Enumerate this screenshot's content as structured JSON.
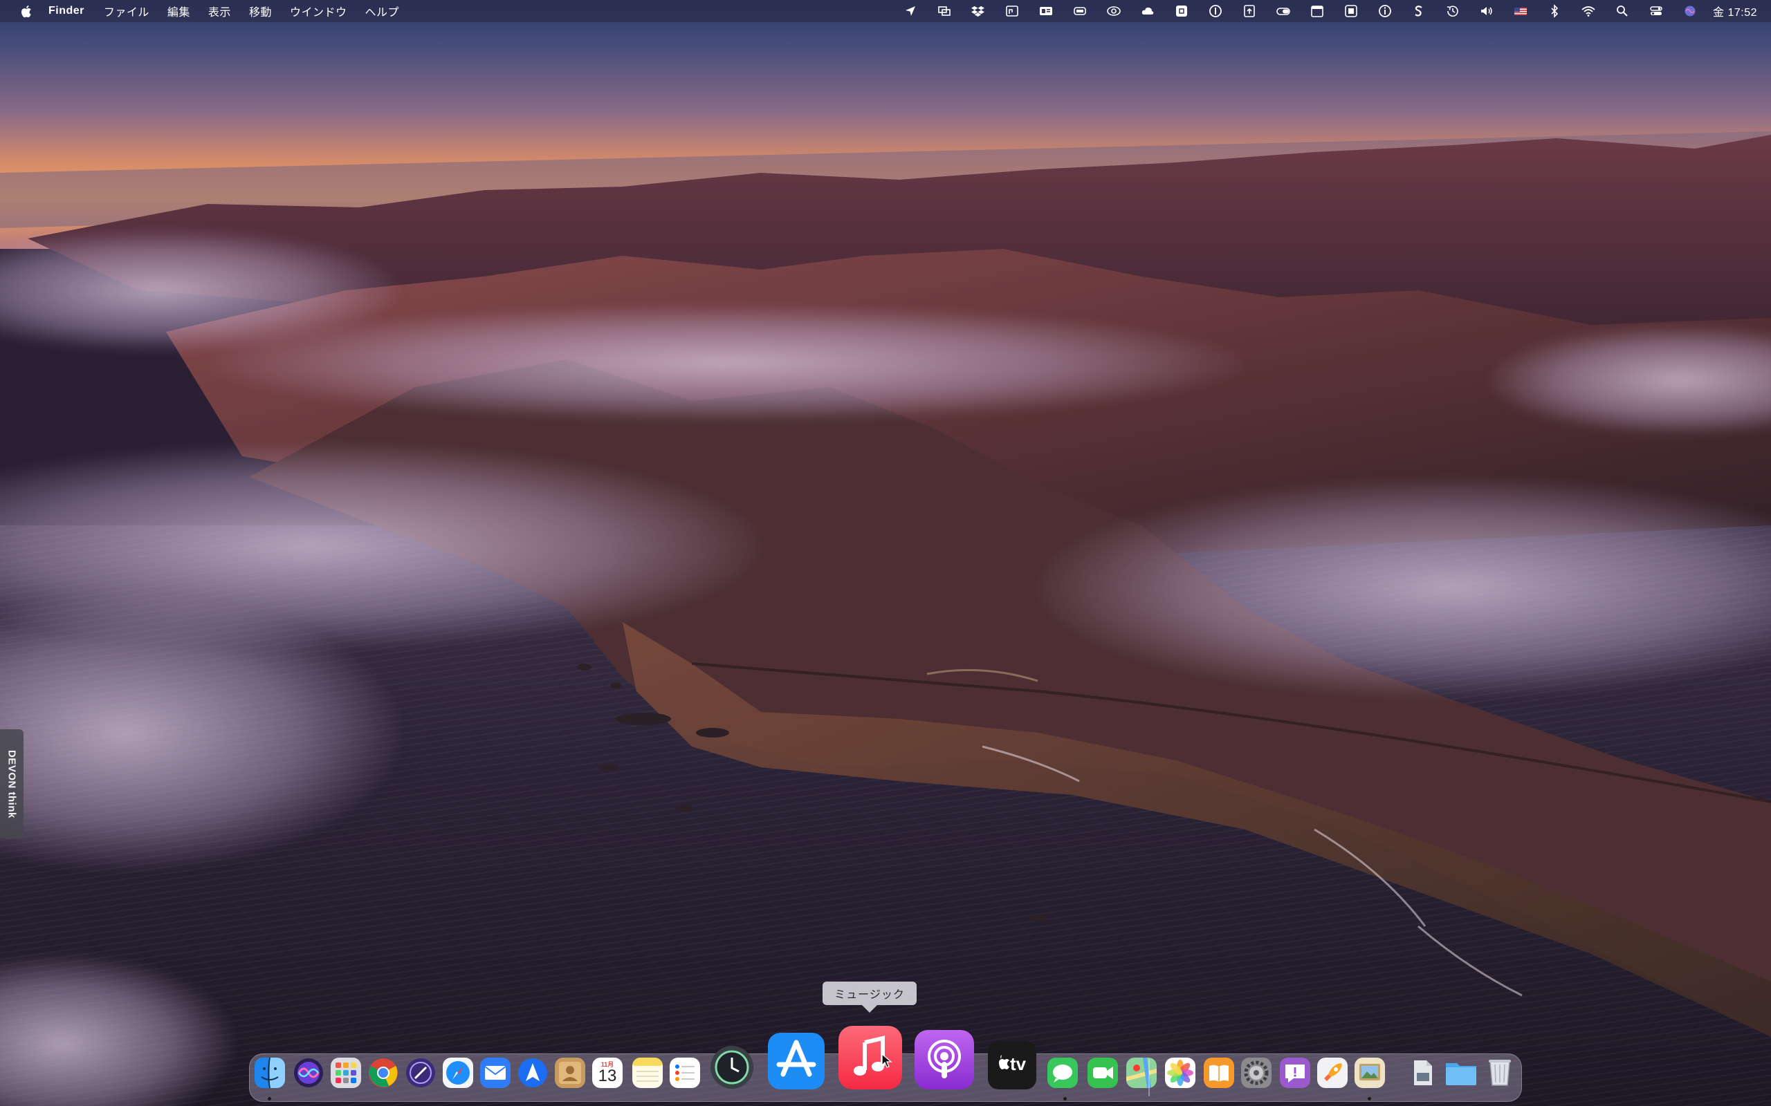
{
  "menubar": {
    "app_name": "Finder",
    "menus": [
      "ファイル",
      "編集",
      "表示",
      "移動",
      "ウインドウ",
      "ヘルプ"
    ],
    "clock": "金 17:52",
    "status_icons": [
      "location-arrow-icon",
      "screen-mirror-icon",
      "dropbox-icon",
      "display-icon",
      "card-icon",
      "battery-app-icon",
      "creative-cloud-icon",
      "cloud-icon",
      "command-icon",
      "one-password-icon",
      "upload-icon",
      "toggle-icon",
      "calendar-icon",
      "stack-icon",
      "info-icon",
      "scrivener-icon",
      "time-machine-icon",
      "volume-icon",
      "us-flag-icon",
      "bluetooth-icon",
      "wifi-icon",
      "spotlight-icon",
      "control-center-icon",
      "siri-icon"
    ]
  },
  "side_tab": {
    "label": "DEVON think"
  },
  "tooltip": {
    "label": "ミュージック"
  },
  "dock": {
    "apps": [
      {
        "name": "finder",
        "color": "#2d8cf0"
      },
      {
        "name": "siri",
        "color": "#6a3fd6"
      },
      {
        "name": "launchpad",
        "color": "#d9d9de"
      },
      {
        "name": "chrome",
        "color": "#ffffff"
      },
      {
        "name": "vpn",
        "color": "#3b2a7a"
      },
      {
        "name": "safari",
        "color": "#1f8fff"
      },
      {
        "name": "mail",
        "color": "#2f7df6"
      },
      {
        "name": "testflight",
        "color": "#1b6ef3"
      },
      {
        "name": "contacts",
        "color": "#c89a5e"
      },
      {
        "name": "calendar",
        "color": "#ffffff"
      },
      {
        "name": "notes",
        "color": "#f7d95c"
      },
      {
        "name": "reminders",
        "color": "#ffffff"
      },
      {
        "name": "time-machine",
        "color": "#3a3e45"
      },
      {
        "name": "app-store",
        "color": "#1d8cf5"
      },
      {
        "name": "music",
        "color": "#f7455b"
      },
      {
        "name": "podcasts",
        "color": "#9b45d6"
      },
      {
        "name": "apple-tv",
        "color": "#1a1a1a"
      },
      {
        "name": "messages",
        "color": "#37c75a"
      },
      {
        "name": "facetime",
        "color": "#35c24f"
      },
      {
        "name": "maps",
        "color": "#6cc07a"
      },
      {
        "name": "photos",
        "color": "#ffffff"
      },
      {
        "name": "books",
        "color": "#f59a2a"
      },
      {
        "name": "system-preferences",
        "color": "#8a8a8f"
      },
      {
        "name": "feedback",
        "color": "#9b59d0"
      },
      {
        "name": "rocket",
        "color": "#f2f2f2"
      },
      {
        "name": "preview",
        "color": "#e8d9b8"
      },
      {
        "name": "documents-folder",
        "color": "#e4e6ea"
      },
      {
        "name": "downloads-folder",
        "color": "#5bb2f0"
      },
      {
        "name": "trash",
        "color": "#c9ccd2"
      }
    ],
    "calendar_month": "11月",
    "calendar_day": "13",
    "tv_label": "tv"
  }
}
